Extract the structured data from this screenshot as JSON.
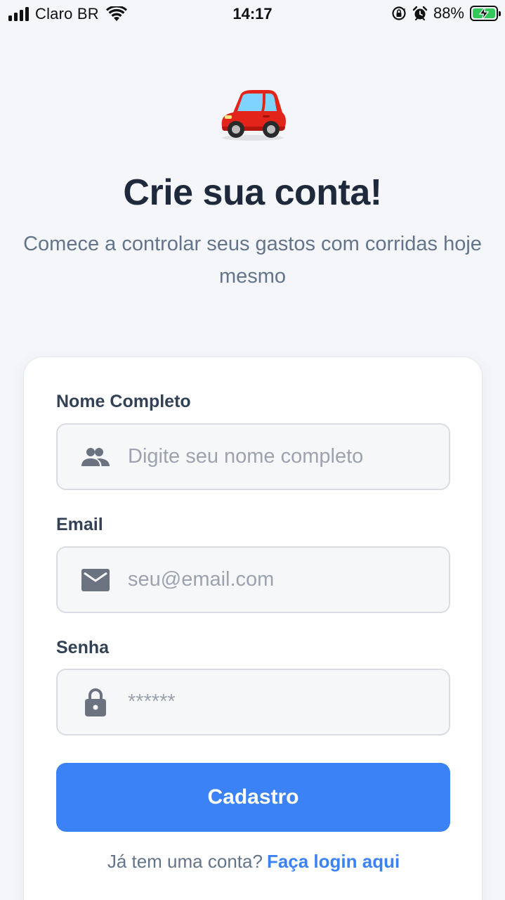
{
  "status_bar": {
    "carrier": "Claro BR",
    "time": "14:17",
    "battery_percent": "88%",
    "battery_charging": true,
    "icons": [
      "signal-icon",
      "wifi-icon",
      "rotation-lock-icon",
      "alarm-icon",
      "battery-icon"
    ]
  },
  "header": {
    "logo_icon": "red-car-icon",
    "title": "Crie sua conta!",
    "subtitle": "Comece a controlar seus gastos com corridas hoje mesmo"
  },
  "form": {
    "name": {
      "label": "Nome Completo",
      "placeholder": "Digite seu nome completo",
      "icon": "people-icon"
    },
    "email": {
      "label": "Email",
      "placeholder": "seu@email.com",
      "icon": "envelope-icon"
    },
    "password": {
      "label": "Senha",
      "placeholder": "******",
      "icon": "lock-icon"
    },
    "submit_label": "Cadastro",
    "login_prompt": "Já tem uma conta?",
    "login_link": "Faça login aqui"
  },
  "colors": {
    "primary": "#3b82f6",
    "title": "#1e293b",
    "subtitle": "#64748b",
    "background": "#f4f6f9",
    "card": "#ffffff",
    "input_bg": "#f6f7f8",
    "input_border": "#d9dde3",
    "placeholder": "#9ca3af",
    "battery_green": "#34c759"
  }
}
